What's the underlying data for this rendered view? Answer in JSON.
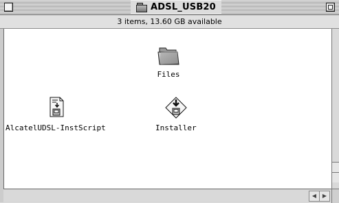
{
  "window": {
    "title": "ADSL_USB20",
    "info": "3 items, 13.60 GB available"
  },
  "items": [
    {
      "label": "Files",
      "icon": "folder-icon"
    },
    {
      "label": "AlcatelUDSL-InstScript",
      "icon": "script-document-icon"
    },
    {
      "label": "Installer",
      "icon": "installer-icon"
    }
  ],
  "scrollbar": {
    "left_arrow": "◀",
    "right_arrow": "▶"
  }
}
